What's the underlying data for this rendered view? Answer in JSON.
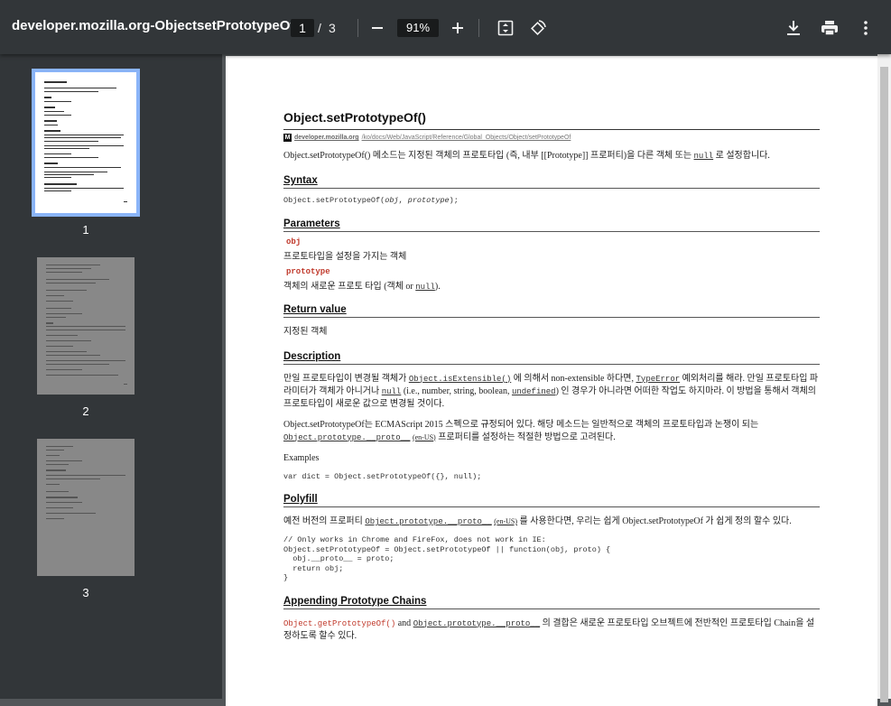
{
  "toolbar": {
    "title": "developer.mozilla.org-ObjectsetPrototypeOf....",
    "current_page": "1",
    "page_sep": "/",
    "page_total": "3",
    "zoom": "91%"
  },
  "sidebar": {
    "pages": [
      {
        "num": "1"
      },
      {
        "num": "2"
      },
      {
        "num": "3"
      }
    ]
  },
  "doc": {
    "title": "Object.setPrototypeOf()",
    "source_domain": "developer.mozilla.org",
    "source_path": "/ko/docs/Web/JavaScript/Reference/Global_Objects/Object/setPrototypeOf",
    "intro_a": "Object.setPrototypeOf() 메소드는 지정된 객체의 프로토타입 (즉, 내부 [[Prototype]] 프로퍼티)을 다른 객체 또는 ",
    "intro_null": "null",
    "intro_b": " 로 설정합니다.",
    "syntax_h": "Syntax",
    "syntax_a": "Object.setPrototypeOf(",
    "syntax_obj": "obj",
    "syntax_comma": ", ",
    "syntax_proto": "prototype",
    "syntax_b": ");",
    "params_h": "Parameters",
    "p1_name": "obj",
    "p1_desc": "프로토타입을 설정을 가지는 객체",
    "p2_name": "prototype",
    "p2_desc_a": "객체의 새로운 프로토 타입 (객체 or ",
    "p2_null": "null",
    "p2_desc_b": ").",
    "ret_h": "Return value",
    "ret_desc": "지정된 객체",
    "desc_h": "Description",
    "desc_a": "만일 프로토타입이 변경될 객체가 ",
    "desc_ext": "Object.isExtensible()",
    "desc_b": " 에 의해서 non-extensible 하다면, ",
    "desc_te": "TypeError",
    "desc_c": " 예외처리를 해라. 만일 프로토타입 파라미터가 객체가 아니거나 ",
    "desc_null": "null",
    "desc_d": " (i.e., number, string, boolean, ",
    "desc_undef": "undefined",
    "desc_e": ") 인 경우가 아니라면 어떠한 작업도 하지마라. 이 방법을 통해서 객체의 프로토타입이 새로운 값으로 변경될 것이다.",
    "es_a": "Object.setPrototypeOf는 ECMAScript 2015 스펙으로 규정되어 있다. 해당 메소드는 일반적으로 객체의 프로토타입과 논쟁이 되는 ",
    "es_proto": "Object.prototype.__proto__",
    "es_enus": "(en-US)",
    "es_b": " 프로퍼티를 설정하는 적절한 방법으로 고려된다.",
    "examples": "Examples",
    "example_code": "var dict = Object.setPrototypeOf({}, null);",
    "poly_h": "Polyfill",
    "poly_a": "예전 버전의 프로퍼티 ",
    "poly_proto": "Object.prototype.__proto__",
    "poly_enus": "(en-US)",
    "poly_b": " 를 사용한다면, 우리는 쉽게 Object.setPrototypeOf 가 쉽게 정의 할수 있다.",
    "poly_code": "// Only works in Chrome and FireFox, does not work in IE:\nObject.setPrototypeOf = Object.setPrototypeOf || function(obj, proto) {\n  obj.__proto__ = proto;\n  return obj;\n}",
    "chain_h": "Appending Prototype Chains",
    "chain_get": "Object.getPrototypeOf()",
    "chain_and": " and ",
    "chain_proto": "Object.prototype.__proto__",
    "chain_b": " 의 결합은 새로운 프로토타입 오브젝트에 전반적인 프로토타입 Chain을 설정하도록 할수 있다."
  }
}
